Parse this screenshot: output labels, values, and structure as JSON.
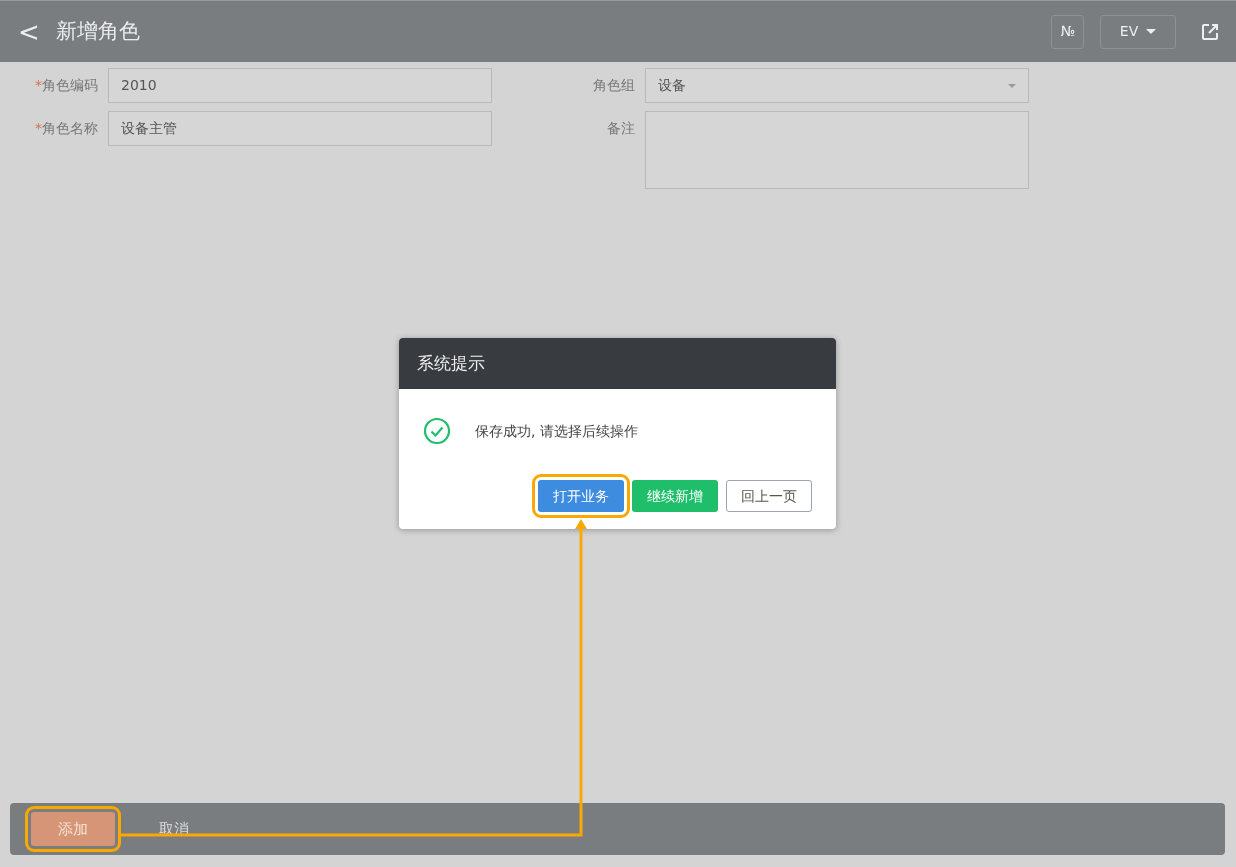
{
  "header": {
    "back": "<",
    "title": "新增角色",
    "number_button": "№",
    "language": "EV"
  },
  "form": {
    "left": [
      {
        "label": "角色编码",
        "required": true,
        "required_mark": "*",
        "kind": "input",
        "value": "2010"
      },
      {
        "label": "角色名称",
        "required": true,
        "required_mark": "*",
        "kind": "input",
        "value": "设备主管"
      }
    ],
    "right": [
      {
        "label": "角色组",
        "required": false,
        "kind": "select",
        "value": "设备"
      },
      {
        "label": "备注",
        "required": false,
        "kind": "textarea"
      }
    ]
  },
  "dialog": {
    "title": "系统提示",
    "message": "保存成功, 请选择后续操作",
    "buttons": [
      {
        "label": "打开业务",
        "kind": "primary",
        "highlighted": true
      },
      {
        "label": "继续新增",
        "kind": "success",
        "highlighted": false
      },
      {
        "label": "回上一页",
        "kind": "outline",
        "highlighted": false
      }
    ]
  },
  "footer": {
    "buttons": [
      {
        "label": "添加",
        "kind": "primary",
        "highlighted": true
      },
      {
        "label": "取消",
        "kind": "link",
        "highlighted": false
      }
    ]
  }
}
